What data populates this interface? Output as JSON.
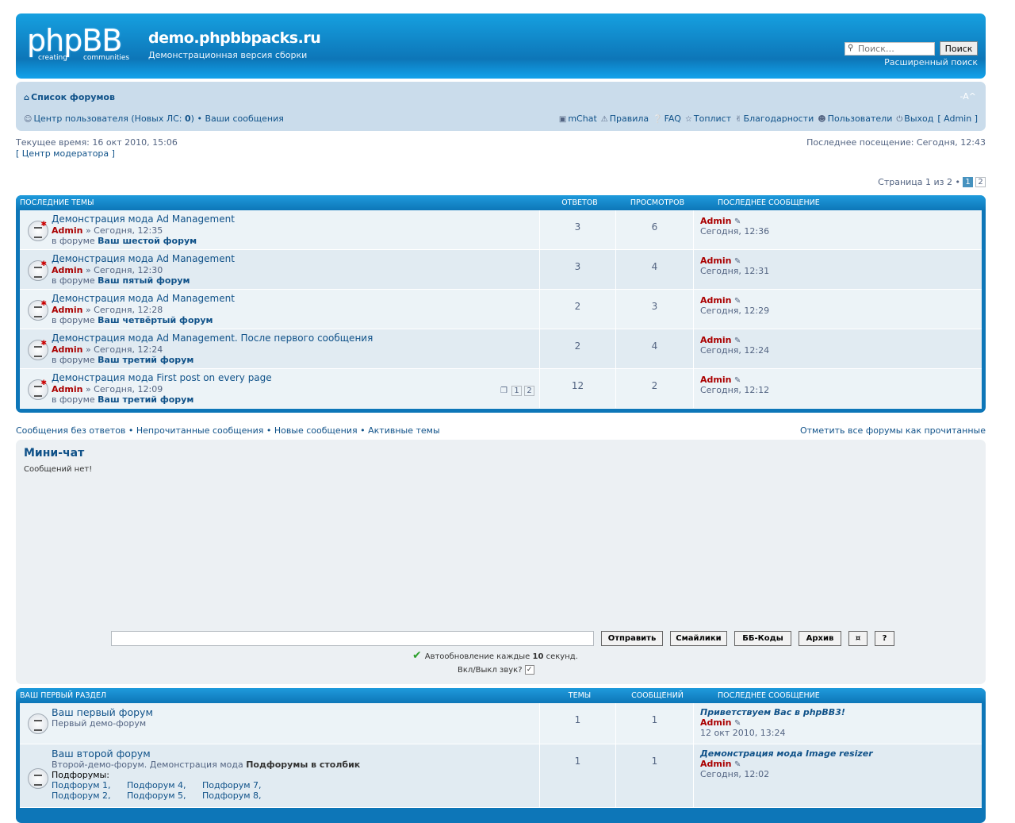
{
  "site": {
    "title": "demo.phpbbpacks.ru",
    "desc": "Демонстрационная версия сборки",
    "logo_big": "phpBB",
    "logo_sub1": "creating",
    "logo_sub2": "communities"
  },
  "search": {
    "placeholder": "Поиск…",
    "button": "Поиск",
    "advanced": "Расширенный поиск"
  },
  "nav": {
    "forum_list": "Список форумов",
    "font_size": "-A^",
    "ucp": "Центр пользователя (Новых ЛС: ",
    "new_pm": "0",
    "ucp_end": ")",
    "your_posts": "• Ваши сообщения",
    "links": [
      {
        "icon": "chat-icon",
        "label": "mChat"
      },
      {
        "icon": "rules-icon",
        "label": "Правила"
      },
      {
        "icon": "faq-icon",
        "label": "FAQ"
      },
      {
        "icon": "star-icon",
        "label": "Топлист"
      },
      {
        "icon": "thanks-icon",
        "label": "Благодарности"
      },
      {
        "icon": "users-icon",
        "label": "Пользователи"
      },
      {
        "icon": "logout-icon",
        "label": "Выход"
      }
    ],
    "logout_user": "[ Admin ]"
  },
  "info": {
    "current_time": "Текущее время: 16 окт 2010, 15:06",
    "last_visit": "Последнее посещение: Сегодня, 12:43",
    "mcp": "[ Центр модератора ]"
  },
  "pagination": {
    "text": "Страница 1 из 2 •",
    "pages": [
      "1",
      "2"
    ]
  },
  "topics_head": {
    "title": "Последние темы",
    "replies": "Ответов",
    "views": "Просмотров",
    "last": "Последнее сообщение"
  },
  "topics": [
    {
      "title": "Демонстрация мода Ad Management",
      "author": "Admin",
      "time": "» Сегодня, 12:35",
      "in": "в форуме ",
      "forum": "Ваш шестой форум",
      "replies": "3",
      "views": "6",
      "last_author": "Admin",
      "last_time": "Сегодня, 12:36"
    },
    {
      "title": "Демонстрация мода Ad Management",
      "author": "Admin",
      "time": "» Сегодня, 12:30",
      "in": "в форуме ",
      "forum": "Ваш пятый форум",
      "replies": "3",
      "views": "4",
      "last_author": "Admin",
      "last_time": "Сегодня, 12:31"
    },
    {
      "title": "Демонстрация мода Ad Management",
      "author": "Admin",
      "time": "» Сегодня, 12:28",
      "in": "в форуме ",
      "forum": "Ваш четвёртый форум",
      "replies": "2",
      "views": "3",
      "last_author": "Admin",
      "last_time": "Сегодня, 12:29"
    },
    {
      "title": "Демонстрация мода Ad Management. После первого сообщения",
      "author": "Admin",
      "time": "» Сегодня, 12:24",
      "in": "в форуме ",
      "forum": "Ваш третий форум",
      "replies": "2",
      "views": "4",
      "last_author": "Admin",
      "last_time": "Сегодня, 12:24"
    },
    {
      "title": "Демонстрация мода First post on every page",
      "author": "Admin",
      "time": "» Сегодня, 12:09",
      "in": "в форуме ",
      "forum": "Ваш третий форум",
      "replies": "12",
      "views": "2",
      "last_author": "Admin",
      "last_time": "Сегодня, 12:12",
      "pages": [
        "1",
        "2"
      ]
    }
  ],
  "quick": {
    "links": "Сообщения без ответов • Непрочитанные сообщения • Новые сообщения • Активные темы",
    "mark": "Отметить все форумы как прочитанные"
  },
  "chat": {
    "title": "Мини-чат",
    "empty": "Сообщений нет!",
    "send": "Отправить",
    "smilies": "Смайлики",
    "bbcodes": "ББ-Коды",
    "archive": "Архив",
    "clear": "¤",
    "help": "?",
    "auto": "Автообновление каждые ",
    "auto_n": "10",
    "auto_end": " секунд.",
    "sound": "Вкл/Выкл звук?"
  },
  "cat_head": {
    "title": "Ваш первый раздел",
    "topics": "Темы",
    "posts": "Сообщений",
    "last": "Последнее сообщение"
  },
  "forums": [
    {
      "title": "Ваш первый форум",
      "desc": "Первый демо-форум",
      "topics": "1",
      "posts": "1",
      "last_title": "Приветствуем Вас в phpBB3!",
      "last_author": "Admin",
      "last_time": "12 окт 2010, 13:24"
    },
    {
      "title": "Ваш второй форум",
      "desc": "Второй-демо-форум. Демонстрация мода ",
      "desc_b": "Подфорумы в столбик",
      "sub_label": "Подфорумы:",
      "subs": [
        "Подфорум 1,",
        "Подфорум 4,",
        "Подфорум 7,",
        "Подфорум 2,",
        "Подфорум 5,",
        "Подфорум 8,"
      ],
      "topics": "1",
      "posts": "1",
      "last_title": "Демонстрация мода Image resizer",
      "last_author": "Admin",
      "last_time": "Сегодня, 12:02"
    }
  ]
}
